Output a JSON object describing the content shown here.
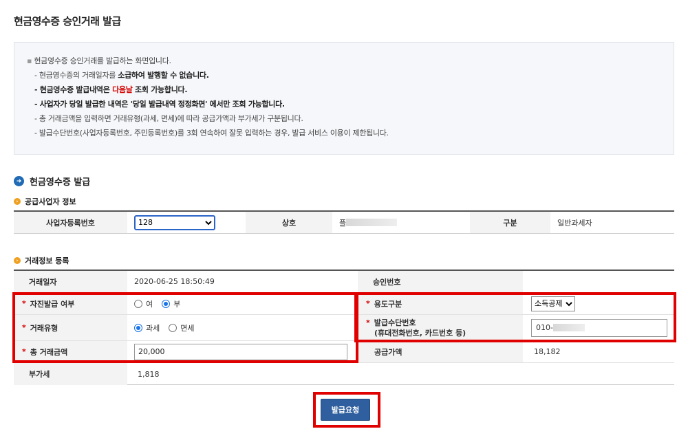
{
  "page": {
    "title": "현금영수증 승인거래 발급"
  },
  "notice": {
    "line1": "현금영수증 승인거래를 발급하는 화면입니다.",
    "line2_prefix": "- 현금영수증의 거래일자를 ",
    "line2_bold": "소급하여 발행할 수 없습니다.",
    "line3_bold_a": "- 현금영수증 발급내역은 ",
    "line3_red": "다음날",
    "line3_bold_b": " 조회 가능합니다.",
    "line4": "- 사업자가 당일 발급한 내역은 '당일 발급내역 정정화면' 에서만 조회 가능합니다.",
    "line5": "- 총 거래금액을 입력하면 거래유형(과세, 면세)에 따라 공급가액과 부가세가 구분됩니다.",
    "line6": "- 발급수단번호(사업자등록번호, 주민등록번호)를 3회 연속하여 잘못 입력하는 경우, 발급 서비스 이용이 제한됩니다."
  },
  "section": {
    "title": "현금영수증 발급"
  },
  "supplier": {
    "title": "공급사업자 정보",
    "biz_no_label": "사업자등록번호",
    "biz_no_value": "128",
    "name_label": "상호",
    "name_value": "플",
    "type_label": "구분",
    "type_value": "일반과세자"
  },
  "transaction": {
    "title": "거래정보 등록",
    "date_label": "거래일자",
    "date_value": "2020-06-25 18:50:49",
    "approval_label": "승인번호",
    "approval_value": "",
    "self_issue_label": "자진발급 여부",
    "self_issue_yes": "여",
    "self_issue_no": "부",
    "self_issue_selected": "부",
    "usage_label": "용도구분",
    "usage_value": "소득공제",
    "tx_type_label": "거래유형",
    "tx_type_taxable": "과세",
    "tx_type_exempt": "면세",
    "tx_type_selected": "과세",
    "means_label_1": "발급수단번호",
    "means_label_2": "(휴대전화번호, 카드번호 등)",
    "means_value": "010-",
    "total_label": "총 거래금액",
    "total_value": "20,000",
    "supply_label": "공급가액",
    "supply_value": "18,182",
    "vat_label": "부가세",
    "vat_value": "1,818"
  },
  "actions": {
    "submit_label": "발급요청"
  },
  "colors": {
    "accent": "#2f5f9e",
    "highlight": "#e00000",
    "required": "#d60000"
  }
}
